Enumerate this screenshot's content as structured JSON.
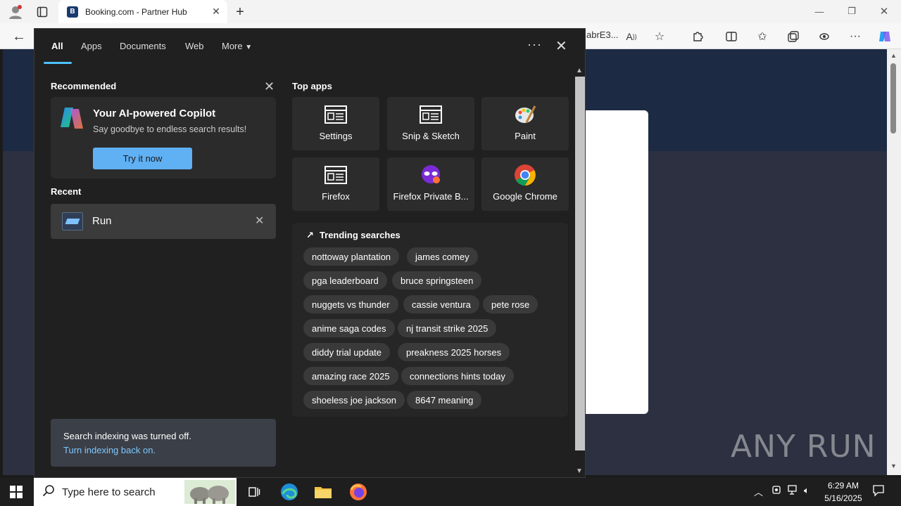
{
  "browser": {
    "tab_title": "Booking.com - Partner Hub",
    "tab_favicon_letter": "B",
    "url_fragment": "abrE3..."
  },
  "search": {
    "tabs": [
      "All",
      "Apps",
      "Documents",
      "Web",
      "More"
    ],
    "active_tab": "All",
    "recommended": {
      "heading": "Recommended",
      "card_title": "Your AI-powered Copilot",
      "card_subtitle": "Say goodbye to endless search results!",
      "card_button": "Try it now"
    },
    "recent": {
      "heading": "Recent",
      "item_label": "Run"
    },
    "indexing": {
      "message": "Search indexing was turned off.",
      "link": "Turn indexing back on."
    },
    "top_apps": {
      "heading": "Top apps",
      "apps": [
        {
          "label": "Settings",
          "icon": "window-icon"
        },
        {
          "label": "Snip & Sketch",
          "icon": "window-icon"
        },
        {
          "label": "Paint",
          "icon": "palette-icon"
        },
        {
          "label": "Firefox",
          "icon": "window-icon"
        },
        {
          "label": "Firefox Private B...",
          "icon": "private-mask-icon"
        },
        {
          "label": "Google Chrome",
          "icon": "chrome-icon"
        }
      ]
    },
    "trending": {
      "heading": "Trending searches",
      "items": [
        "nottoway plantation",
        "james comey",
        "pga leaderboard",
        "bruce springsteen",
        "nuggets vs thunder",
        "cassie ventura",
        "pete rose",
        "anime saga codes",
        "nj transit strike 2025",
        "diddy trial update",
        "preakness 2025 horses",
        "amazing race 2025",
        "connections hints today",
        "shoeless joe jackson",
        "8647 meaning"
      ]
    }
  },
  "taskbar": {
    "search_placeholder": "Type here to search",
    "time": "6:29 AM",
    "date": "5/16/2025"
  },
  "watermark": "ANY RUN",
  "colors": {
    "accent": "#4cc2ff",
    "flyout_bg": "#202020",
    "button_blue": "#60b0f4",
    "link_blue": "#7ec7ff"
  }
}
